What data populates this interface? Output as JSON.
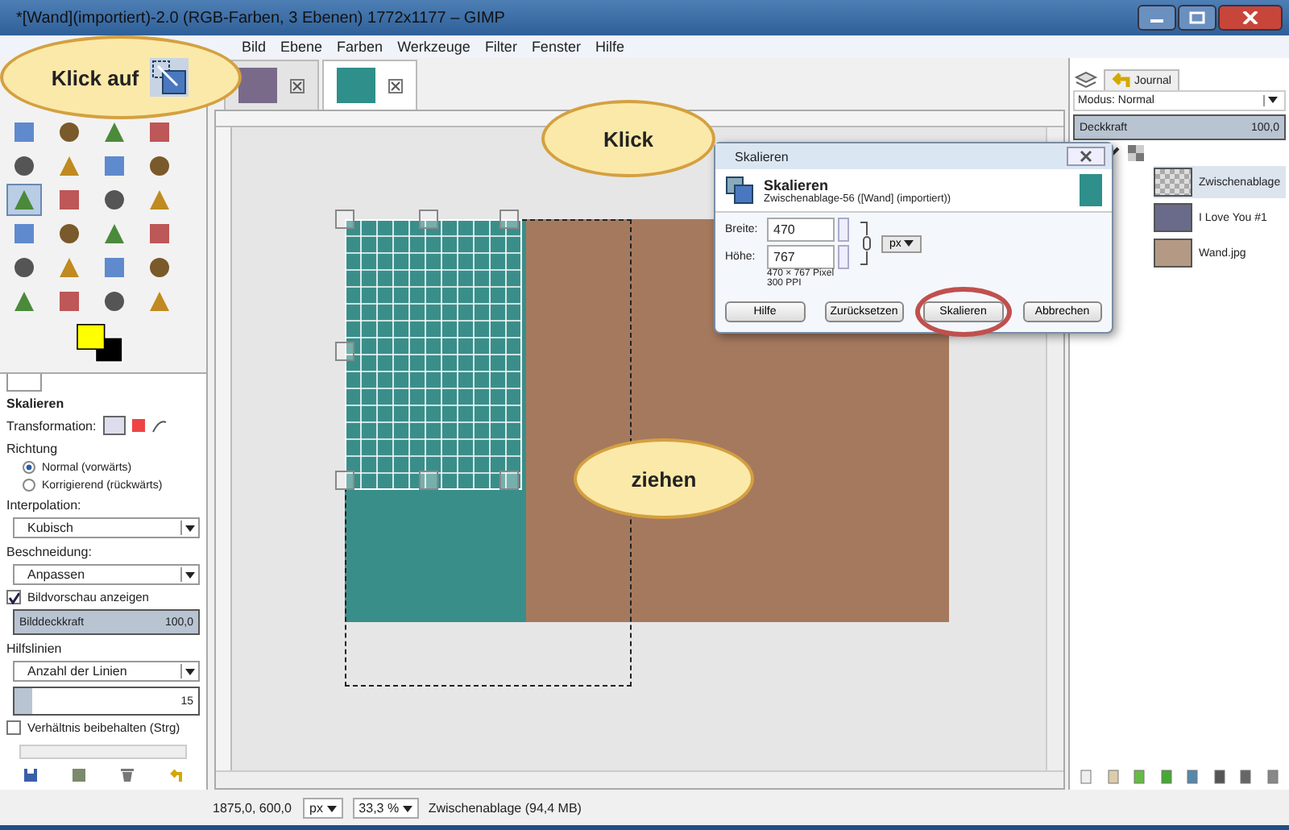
{
  "window": {
    "title": "*[Wand](importiert)-2.0 (RGB-Farben, 3 Ebenen) 1772x1177 – GIMP"
  },
  "menu": [
    "Bild",
    "Ebene",
    "Farben",
    "Werkzeuge",
    "Filter",
    "Fenster",
    "Hilfe"
  ],
  "callouts": [
    {
      "text": "Klick auf"
    },
    {
      "text": "Klick"
    },
    {
      "text": "ziehen"
    }
  ],
  "toolbox": {
    "tools": [
      {
        "selected": false
      },
      {
        "selected": false
      },
      {
        "selected": false
      },
      {
        "selected": false
      },
      {
        "selected": false
      },
      {
        "selected": false
      },
      {
        "selected": false
      },
      {
        "selected": false
      },
      {
        "selected": true
      },
      {
        "selected": false
      },
      {
        "selected": false
      },
      {
        "selected": false
      },
      {
        "selected": false
      },
      {
        "selected": false
      },
      {
        "selected": false
      },
      {
        "selected": false
      },
      {
        "selected": false
      },
      {
        "selected": false
      },
      {
        "selected": false
      },
      {
        "selected": false
      },
      {
        "selected": false
      },
      {
        "selected": false
      },
      {
        "selected": false
      },
      {
        "selected": false
      }
    ]
  },
  "tool_options": {
    "title": "Skalieren",
    "transformation_label": "Transformation:",
    "direction_label": "Richtung",
    "directions": [
      {
        "label": "Normal (vorwärts)",
        "selected": true
      },
      {
        "label": "Korrigierend (rückwärts)",
        "selected": false
      }
    ],
    "interpolation_label": "Interpolation:",
    "interpolation": "Kubisch",
    "clipping_label": "Beschneidung:",
    "clipping": "Anpassen",
    "preview": {
      "label": "Bildvorschau anzeigen",
      "checked": true
    },
    "opacity": {
      "label": "Bilddeckkraft",
      "reading": "100,0",
      "level": 1
    },
    "guides_label": "Hilfslinien",
    "guides": "Anzahl der Linien",
    "guide_count": {
      "reading": "15",
      "level": 0.1
    },
    "keep_ratio": {
      "label": "Verhältnis beibehalten (Strg)",
      "checked": false
    }
  },
  "image_tabs": [
    {
      "selected": false
    },
    {
      "selected": true
    }
  ],
  "dialog": {
    "window_title": "Skalieren",
    "heading": "Skalieren",
    "subtitle": "Zwischenablage-56 ([Wand] (importiert))",
    "fields": [
      {
        "label": "Breite:",
        "value": "470"
      },
      {
        "label": "Höhe:",
        "value": "767"
      }
    ],
    "unit": "px",
    "size_info": "470 × 767 Pixel",
    "resolution": "300 PPI",
    "buttons": [
      {
        "label": "Hilfe",
        "highlighted": false
      },
      {
        "label": "Zurücksetzen",
        "highlighted": false
      },
      {
        "label": "Skalieren",
        "highlighted": true
      },
      {
        "label": "Abbrechen",
        "highlighted": false
      }
    ]
  },
  "layers": {
    "tab": "Journal",
    "mode_label": "Modus:",
    "mode": "Normal",
    "opacity": {
      "label": "Deckkraft",
      "reading": "100,0",
      "level": 1
    },
    "items": [
      {
        "name": "Zwischenablage",
        "selected": true
      },
      {
        "name": "I Love You #1",
        "selected": false
      },
      {
        "name": "Wand.jpg",
        "selected": false
      }
    ]
  },
  "status_bar": {
    "coords": "1875,0, 600,0",
    "unit": "px",
    "zoom": "33,3 %",
    "message": "Zwischenablage (94,4 MB)"
  }
}
